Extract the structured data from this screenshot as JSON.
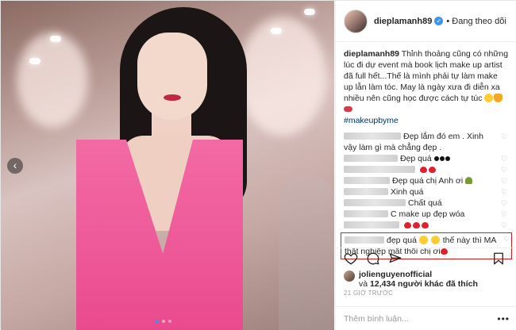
{
  "post": {
    "username": "dieplamanh89",
    "verified_icon": "verified-badge-icon",
    "following_label": "• Đang theo dõi",
    "caption_text": "Thỉnh thoảng cũng có những lúc đi dự event mà book lịch make up artist đã full hết...Thế là mình phải tự làm make up lẫn làm tóc. May là ngày xưa đi diễn xa nhiều nên cũng học được cách tự túc",
    "hashtag": "#makeupbyme"
  },
  "comments": [
    {
      "text": "Đẹp lắm đó em . Xinh vậy làm gì mà chẳng đẹp ."
    },
    {
      "text": "Đẹp quá"
    },
    {
      "text": ""
    },
    {
      "text": "Đẹp quá chị Anh ơi"
    },
    {
      "text": "Xinh quá"
    },
    {
      "text": "Chất quá"
    },
    {
      "text": "C make up đẹp wóa"
    },
    {
      "text": ""
    },
    {
      "text_part1": "đẹp quá",
      "text_part2": "thế này thì MA thất nghiệp mất thôi chị ơi"
    }
  ],
  "likes": {
    "liker": "jolienguyenofficial",
    "and_label": "và",
    "count_text": "12,434 người khác đã thích"
  },
  "time_label": "21 GIỜ TRƯỚC",
  "add_comment_placeholder": "Thêm bình luận...",
  "more_label": "•••",
  "prev_arrow": "‹",
  "colors": {
    "accent": "#3897f0",
    "highlight": "#d81b23",
    "dress": "#ee5898"
  }
}
